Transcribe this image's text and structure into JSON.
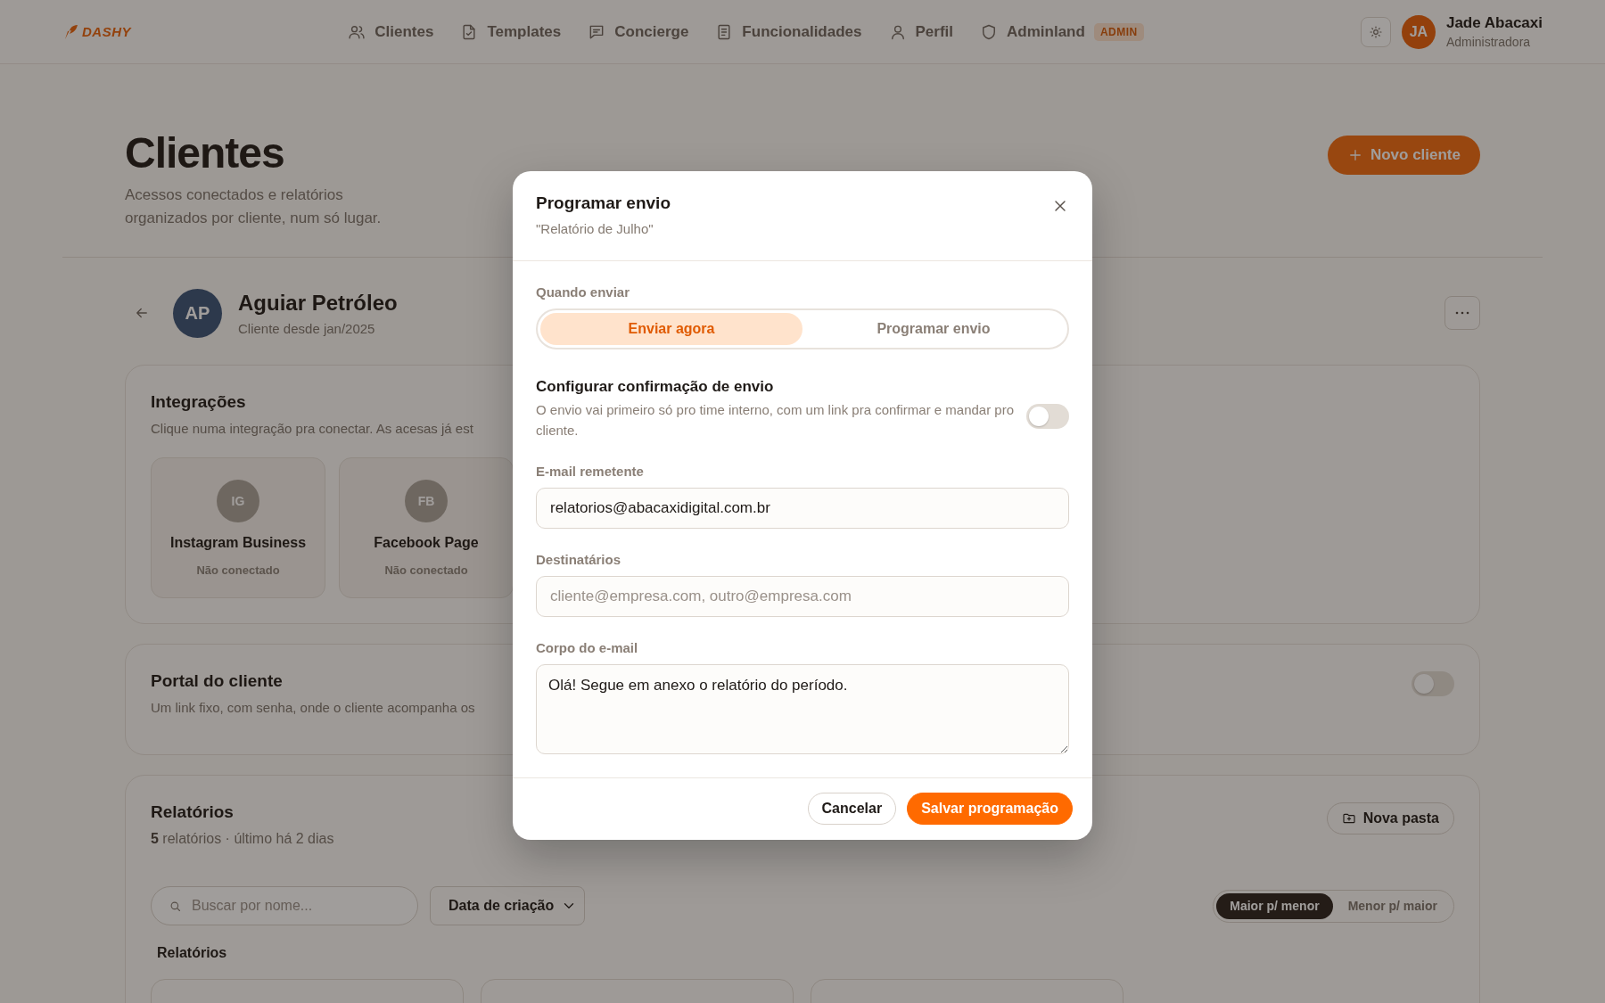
{
  "nav": {
    "logo": "DASHY",
    "items": [
      {
        "label": "Clientes"
      },
      {
        "label": "Templates"
      },
      {
        "label": "Concierge"
      },
      {
        "label": "Funcionalidades"
      },
      {
        "label": "Perfil"
      },
      {
        "label": "Adminland",
        "badge": "ADMIN"
      }
    ],
    "user": {
      "initials": "JA",
      "name": "Jade Abacaxi",
      "role": "Administradora"
    }
  },
  "page": {
    "title": "Clientes",
    "subtitle": "Acessos conectados e relatórios organizados por cliente, num só lugar.",
    "new_button": "Novo cliente"
  },
  "client": {
    "initials": "AP",
    "name": "Aguiar Petróleo",
    "since": "Cliente desde jan/2025"
  },
  "integrations": {
    "title": "Integrações",
    "description": "Clique numa integração pra conectar. As acesas já est",
    "items": [
      {
        "initials": "IG",
        "name": "Instagram Business",
        "status": "Não conectado"
      },
      {
        "initials": "FB",
        "name": "Facebook Page",
        "status": "Não conectado"
      }
    ]
  },
  "portal": {
    "title": "Portal do cliente",
    "description": "Um link fixo, com senha, onde o cliente acompanha os",
    "on": false
  },
  "reports": {
    "title": "Relatórios",
    "summary": "**5** relatórios · último há 2 dias",
    "new_folder": "Nova pasta",
    "search": {
      "placeholder": "Buscar por nome..."
    },
    "sort_field": "Data de criação",
    "order": [
      {
        "label": "Maior p/ menor",
        "selected": true
      },
      {
        "label": "Menor p/ maior",
        "selected": false
      }
    ],
    "section_label": "Relatórios"
  },
  "modal": {
    "title": "Programar envio",
    "subtitle": "\"Relatório de Julho\"",
    "when_label": "Quando enviar",
    "when_options": [
      {
        "label": "Enviar agora",
        "selected": true
      },
      {
        "label": "Programar envio",
        "selected": false
      }
    ],
    "confirm": {
      "title": "Configurar confirmação de envio",
      "description": "O envio vai primeiro só pro time interno, com um link pra confirmar e mandar pro cliente.",
      "on": false
    },
    "sender": {
      "label": "E-mail remetente",
      "value": "relatorios@abacaxidigital.com.br"
    },
    "recipients": {
      "label": "Destinatários",
      "placeholder": "cliente@empresa.com, outro@empresa.com"
    },
    "body": {
      "label": "Corpo do e-mail",
      "value": "Olá! Segue em anexo o relatório do período."
    },
    "buttons": [
      {
        "label": "Cancelar",
        "kind": "secondary"
      },
      {
        "label": "Salvar programação",
        "kind": "primary"
      }
    ]
  }
}
